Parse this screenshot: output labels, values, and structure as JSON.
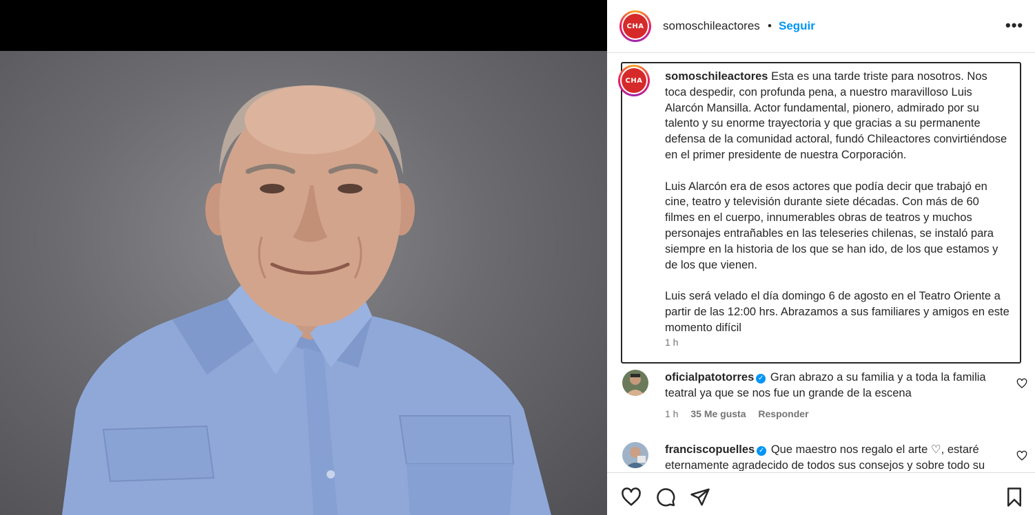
{
  "post": {
    "username": "somoschileactores",
    "separator": "•",
    "follow_label": "Seguir",
    "more_label": "•••",
    "avatar_text": "CHA"
  },
  "caption": {
    "username": "somoschileactores",
    "paragraphs": [
      "Esta es una tarde triste para nosotros. Nos toca despedir, con profunda pena, a nuestro maravilloso Luis Alarcón Mansilla. Actor fundamental, pionero, admirado por su talento y su enorme trayectoria y que gracias a su permanente defensa de la comunidad actoral, fundó Chileactores convirtiéndose en el primer presidente de nuestra Corporación.",
      "Luis Alarcón era de esos actores que podía decir que trabajó en cine, teatro y televisión durante siete décadas. Con más de 60 filmes en el cuerpo, innumerables obras de teatros y muchos personajes entrañables en las teleseries chilenas, se instaló para siempre en la historia de los que se han ido, de los que estamos y de los que vienen.",
      "Luis será velado el día domingo 6 de agosto en el Teatro Oriente a partir de las 12:00 hrs. Abrazamos a sus familiares y amigos en este momento difícil"
    ],
    "time": "1 h"
  },
  "comments": [
    {
      "username": "oficialpatotorres",
      "verified": "✓",
      "text": "Gran abrazo a su familia y a toda la familia teatral ya que se nos fue un grande de la escena",
      "time": "1 h",
      "likes": "35 Me gusta",
      "reply_label": "Responder"
    },
    {
      "username": "franciscopuelles",
      "verified": "✓",
      "text": "Que maestro nos regalo el arte ♡, estaré eternamente agradecido de todos sus consejos y sobre todo su",
      "time": "",
      "likes": "",
      "reply_label": ""
    }
  ],
  "icons": {
    "like": "heart-icon",
    "comment": "comment-icon",
    "share": "send-icon",
    "save": "bookmark-icon"
  },
  "colors": {
    "accent": "#0095f6",
    "logo_red": "#d62a2a",
    "shirt": "#8fa8d8"
  }
}
